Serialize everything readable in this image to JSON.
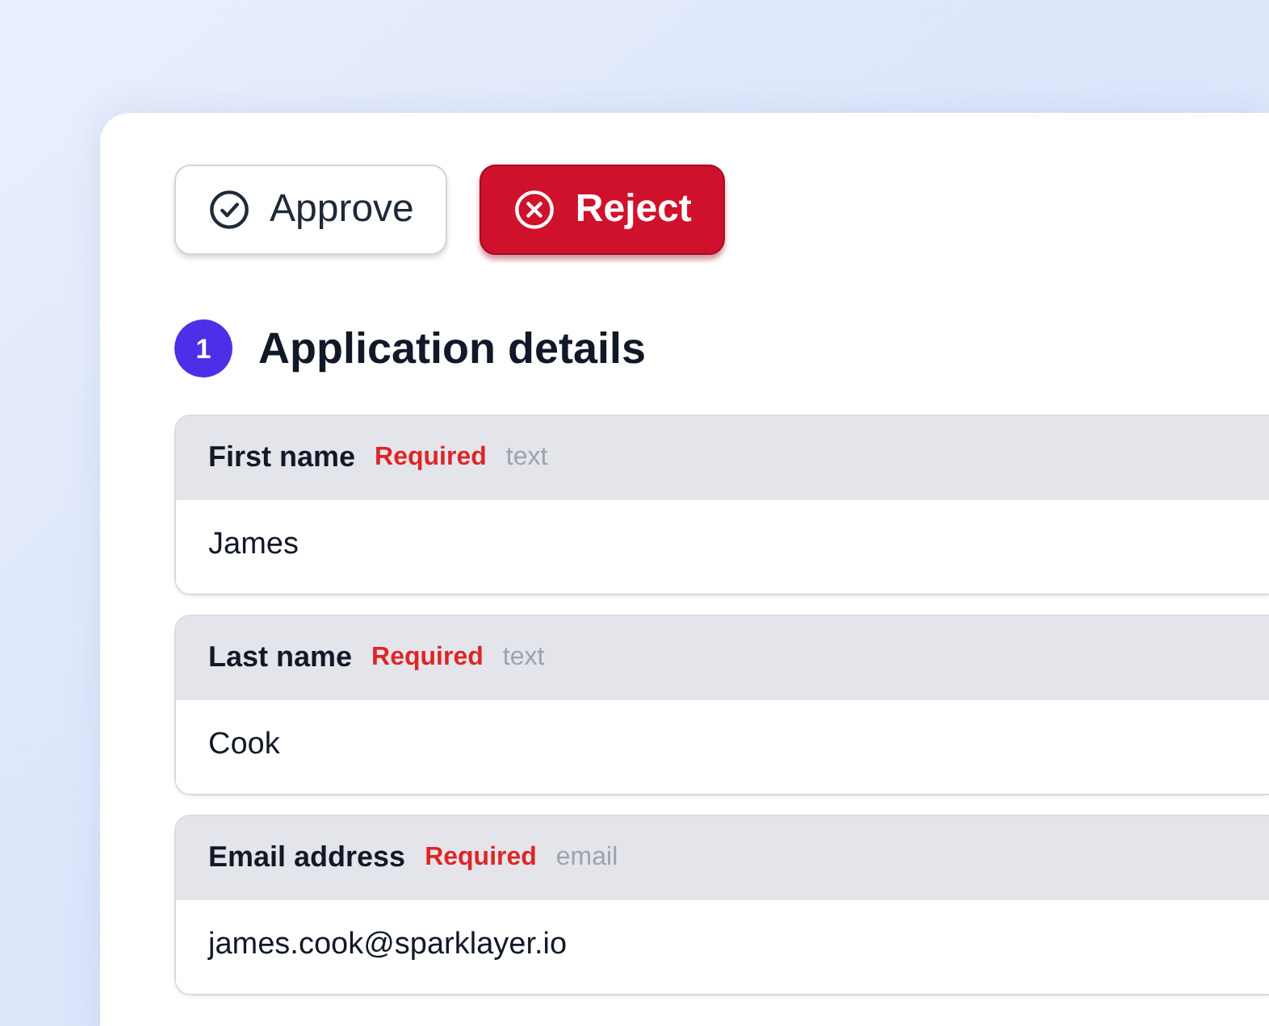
{
  "actions": [
    {
      "label": "Approve",
      "kind": "approve"
    },
    {
      "label": "Reject",
      "kind": "reject"
    }
  ],
  "section": {
    "number": "1",
    "title": "Application details"
  },
  "fields": [
    {
      "label": "First name",
      "required": "Required",
      "type": "text",
      "value": "James"
    },
    {
      "label": "Last name",
      "required": "Required",
      "type": "text",
      "value": "Cook"
    },
    {
      "label": "Email address",
      "required": "Required",
      "type": "email",
      "value": "james.cook@sparklayer.io"
    }
  ]
}
